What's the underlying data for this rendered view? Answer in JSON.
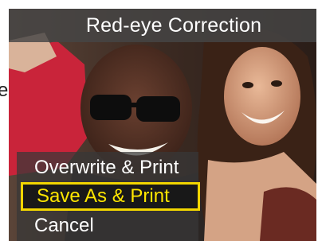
{
  "screen": {
    "title": "Red-eye Correction"
  },
  "menu": {
    "items": [
      {
        "label": "Overwrite & Print",
        "selected": false
      },
      {
        "label": "Save As & Print",
        "selected": true
      },
      {
        "label": "Cancel",
        "selected": false
      }
    ]
  },
  "page_margin_fragment": "e",
  "colors": {
    "highlight": "#ffe600",
    "highlight_border": "#f2d600",
    "menu_text": "#ffffff",
    "title_bar": "#464646"
  }
}
